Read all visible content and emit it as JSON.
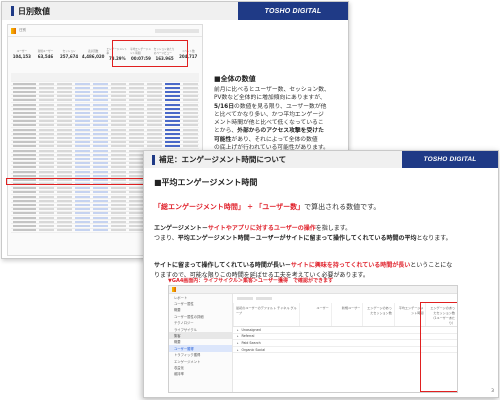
{
  "brand": "TOSHO DIGITAL",
  "back_slide": {
    "title": "日別数値",
    "dashboard": {
      "tool_title": "日別",
      "metrics": [
        {
          "label": "ユーザー",
          "value": "104,153",
          "sub": ""
        },
        {
          "label": "新規ユーザー",
          "value": "63,546",
          "sub": ""
        },
        {
          "label": "セッション",
          "value": "257,674",
          "sub": ""
        },
        {
          "label": "表示回数",
          "value": "4,486,020",
          "sub": ""
        },
        {
          "label": "エンゲージメント率",
          "value": "73.29%",
          "sub": ""
        },
        {
          "label": "平均エンゲージメント時間",
          "value": "00:07:59",
          "sub": ""
        },
        {
          "label": "セッションあたりのページビュー",
          "value": "163.965",
          "sub": ""
        },
        {
          "label": "イベント数",
          "value": "204,717",
          "sub": ""
        }
      ]
    },
    "text": {
      "heading": "■全体の数値",
      "line1": "前月に比べるとユーザー数、セッション数、",
      "line2": "PV数など全体的に増加傾向にありますが、",
      "line3_bold": "5/16日",
      "line3_rest": "の数値を見る限り、ユーザー数が他",
      "line4": "と比べてかなり多い、かつ平均エンゲージ",
      "line5": "メント時間が他と比べて低くなっているこ",
      "line6_pre": "とから、",
      "line6_bold": "外部からのアクセス攻撃を受けた",
      "line7_bold": "可能性",
      "line7_rest": "があり、それによって全体の数値",
      "line8": "の底上げが行われている可能性があります。"
    }
  },
  "front_slide": {
    "title": "補足：エンゲージメント時間について",
    "heading": "■平均エンゲージメント時間",
    "formula": {
      "term1": "「総エンゲージメント時間」",
      "op": "÷",
      "term2": "「ユーザー数」",
      "rest": "で算出される数値です。"
    },
    "definition": {
      "l1_pre": "エンゲージメント－",
      "l1_red": "サイトやアプリに対するユーザーの操作",
      "l1_post": "を指します。",
      "l2_pre": "つまり、",
      "l2_bold": "平均エンゲージメント時間－ユーザーがサイトに留まって操作してくれている時間の平均",
      "l2_post": "となります。"
    },
    "paragraph": {
      "l1_pre": "サイトに留まって操作してくれている時間が長い－",
      "l1_red": "サイトに興味を持ってくれている時間が長い",
      "l1_post": "ということにな",
      "l2": "りますので、可能な限りこの時間を延ばせる工夫を考えていく必要があります。"
    },
    "path_note": "▼GA4画面内：ライフサイクル＞集客＞ユーザー獲得　で確認ができます",
    "screenshot": {
      "sidebar_items": [
        "レポート",
        "ユーザー属性",
        "概要",
        "ユーザー属性の詳細",
        "テクノロジー",
        "ライフサイクル",
        "集客",
        "概要",
        "ユーザー獲得",
        "トラフィック獲得",
        "エンゲージメント",
        "収益化",
        "維持率"
      ],
      "columns": [
        "最初のユーザーのデフォルト チャネル グループ",
        "ユーザー",
        "新規ユーザー",
        "エンゲージのあったセッション数",
        "平均エンゲージメント時間",
        "エンゲージのあったセッション数（1ユーザーあたり）"
      ],
      "rows": [
        "Unassigned",
        "Referral",
        "Paid Search",
        "Organic Social"
      ]
    },
    "page_number": "3"
  }
}
